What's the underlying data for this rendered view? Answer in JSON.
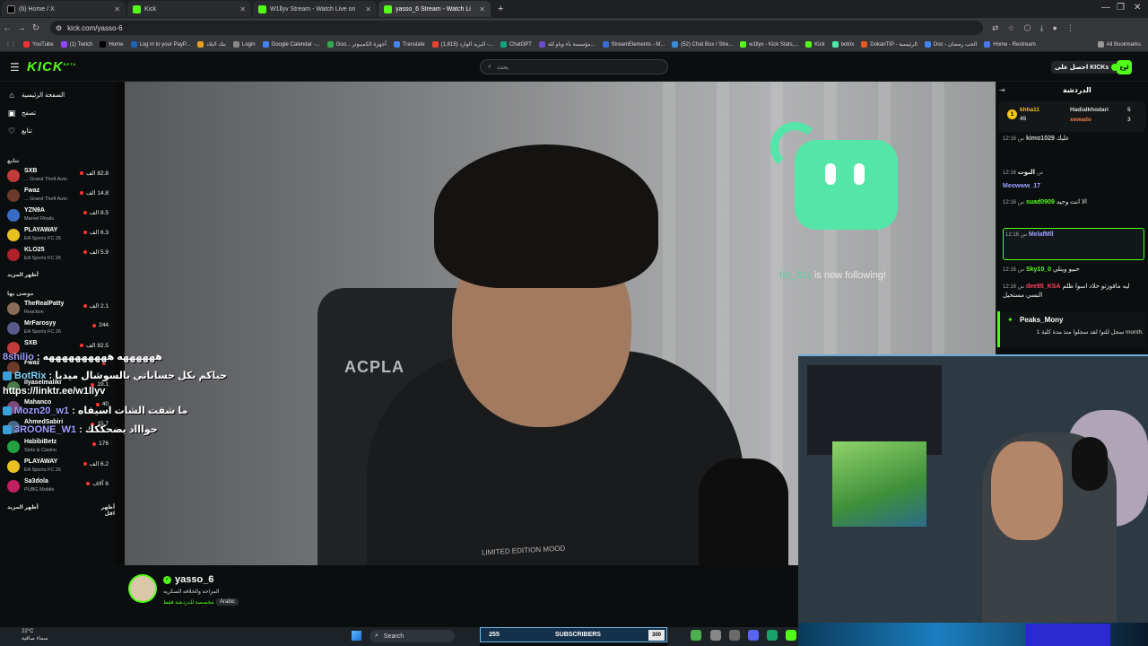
{
  "browser": {
    "tabs": [
      {
        "label": "(6) Home / X",
        "favicon": "x-icon",
        "active": false
      },
      {
        "label": "Kick",
        "favicon": "kick-icon",
        "active": false
      },
      {
        "label": "W1llyv Stream - Watch Live on",
        "favicon": "kick-icon",
        "active": false
      },
      {
        "label": "yasso_6 Stream - Watch Li",
        "favicon": "kick-icon",
        "active": true
      }
    ],
    "url": "kick.com/yasso-6",
    "bookmarks": [
      "YouTube",
      "(1) Twitch",
      "Home",
      "Log in to your PayP...",
      "بنك البلاد",
      "Login",
      "Google Calendar -...",
      "Goo... أجهزة الكمبيوتر",
      "Translate",
      "(1,815) البريد الوارد -...",
      "ChatGPT",
      "مؤسسة باء وياو للة...",
      "StreamElements - M...",
      "(52) Chat Box / Stre...",
      "w1llyv - Kick Stats,...",
      "Kick",
      "botrix",
      "DokanTIP - الرئيسية",
      "Doc - الحب رمضان",
      "Home - Restream"
    ],
    "all_bookmarks": "All Bookmarks"
  },
  "header": {
    "logo": "KICK",
    "logo_sup": "BETA",
    "search_placeholder": "بحث",
    "get_kicks": "احصل على KICKs",
    "login": "لوغ"
  },
  "sidebar": {
    "nav": [
      {
        "label": "الصفحة الرئيسية",
        "icon": "home-icon"
      },
      {
        "label": "تصفح",
        "icon": "browse-icon"
      },
      {
        "label": "تتابع",
        "icon": "heart-icon"
      }
    ],
    "following_header": "تتابع",
    "following": [
      {
        "name": "SXB",
        "game": "Grand Theft Auto ...",
        "viewers": "82.8 الف",
        "color": "#c23b3b"
      },
      {
        "name": "Fwaz",
        "game": "Grand Theft Auto ...",
        "viewers": "14.8 الف",
        "color": "#6b3a2a"
      },
      {
        "name": "YZN9A",
        "game": "Marvel Rivals",
        "viewers": "8.5 الف",
        "color": "#3a6bc2"
      },
      {
        "name": "PLAYAWAY",
        "game": "EA Sports FC 26",
        "viewers": "6.3 الف",
        "color": "#e8c020"
      },
      {
        "name": "KLO25",
        "game": "EA Sports FC 26",
        "viewers": "5.9 الف",
        "color": "#b0202a"
      }
    ],
    "show_more_1": "أظهر المزيد",
    "recommended_header": "موصى بها",
    "recommended": [
      {
        "name": "TheRealPatty",
        "game": "Reaction",
        "viewers": "2.1 الف",
        "color": "#8a6a5a"
      },
      {
        "name": "MrFarosyy",
        "game": "EA Sports FC 26",
        "viewers": "244",
        "color": "#5a5a8a"
      },
      {
        "name": "SXB",
        "game": "",
        "viewers": "82.5 الف",
        "color": "#c23b3b"
      },
      {
        "name": "Fwaz",
        "game": "",
        "viewers": "",
        "color": "#6b3a2a"
      },
      {
        "name": "Ilyaselmaliki",
        "game": "",
        "viewers": "19.1",
        "color": "#4a7a4a"
      },
      {
        "name": "Mahanco",
        "game": "",
        "viewers": "40",
        "color": "#7a4a7a"
      },
      {
        "name": "AhmedSabiri",
        "game": "",
        "viewers": "15.7",
        "color": "#4a6a8a"
      },
      {
        "name": "HabibiBetz",
        "game": "Slots & Casino",
        "viewers": "176",
        "color": "#20a040"
      },
      {
        "name": "PLAYAWAY",
        "game": "EA Sports FC 26",
        "viewers": "6.2 الف",
        "color": "#e8c020"
      },
      {
        "name": "Sa3dola",
        "game": "PUBG Mobile",
        "viewers": "6 آلاف",
        "color": "#c02060"
      }
    ],
    "show_more_2": "أظهر المزيد",
    "show_less": "أظهر اقل"
  },
  "player": {
    "follow_alert_user": "fat_911",
    "follow_alert_text": "is now following!",
    "chair_text": "ACPLA",
    "hoodie_text": "LIMITED EDITION MOOD",
    "overlay_chat": [
      {
        "user": "8shilio",
        "text": "ههههههه ههههههههههه"
      },
      {
        "user": "BotRix",
        "text": "حياكم بكل حساباتي بالسوشال ميديا"
      },
      {
        "user": "",
        "text": "https://linktr.ee/w1llyv"
      },
      {
        "user": "Mozn20_w1",
        "text": "ما شفت الشات اسيفاه"
      },
      {
        "user": "3ROONE_W1",
        "text": "جواااد يضحككك"
      }
    ],
    "subs_count": "255",
    "subs_label": "SUBSCRIBERS",
    "subs_goal": "300"
  },
  "stream": {
    "username": "yasso_6",
    "title": "المزاحه والخلافه السكريه",
    "category": "مخصصة للدردشة فقط",
    "language": "Arabic"
  },
  "chat": {
    "title": "الدردشة",
    "pinned_top": [
      {
        "user": "khha11",
        "count": "45"
      },
      {
        "user": "Hadialkhodari",
        "count": "5"
      },
      {
        "user": "xewado",
        "count": "3"
      }
    ],
    "messages": [
      {
        "time": "12:16 س",
        "user": "kimo1029",
        "color": "#c8c8c8",
        "text": "عليك"
      },
      {
        "time": "12:16 س",
        "user": "البوت",
        "color": "#ffffff",
        "text": ""
      },
      {
        "time": "",
        "user": "Meowww_17",
        "color": "#9ea0ff",
        "text": ""
      },
      {
        "time": "12:16 س",
        "user": "suad0909",
        "color": "#53fc18",
        "text": "الا انت وحيد"
      },
      {
        "time": "12:16 س",
        "user": "MelafMll",
        "color": "#9ea0ff",
        "text": ""
      },
      {
        "time": "12:16 س",
        "user": "Sky10_0",
        "color": "#53fc18",
        "text": "حبيو وينلي"
      },
      {
        "time": "12:16 س",
        "user": "dee95_KSA",
        "color": "#ff4060",
        "text": "ليه مافوزتو خلاد اسوا ظلم النسي مستحيل"
      }
    ],
    "sub_notice_user": "Peaks_Mony",
    "sub_notice_text": "سجل للتو! لقد سجلوا منذ مدة كلية 1 month."
  },
  "taskbar": {
    "temp": "22°C",
    "weather": "سماء صافية",
    "search": "Search"
  }
}
